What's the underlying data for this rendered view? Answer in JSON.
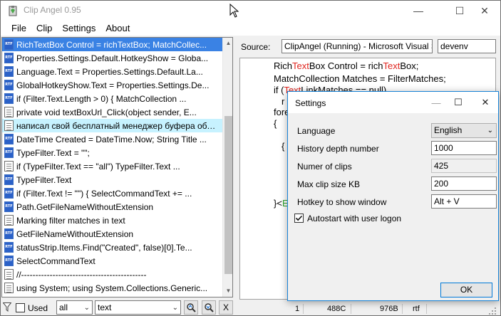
{
  "window": {
    "title": "Clip Angel 0.95",
    "minimize_glyph": "—",
    "maximize_glyph": "☐",
    "close_glyph": "✕"
  },
  "menu": [
    "File",
    "Clip",
    "Settings",
    "About"
  ],
  "clips": [
    {
      "icon": "rtf",
      "text": "RichTextBox Control = richTextBox; MatchCollec...",
      "state": "selected"
    },
    {
      "icon": "rtf",
      "text": "Properties.Settings.Default.HotkeyShow = Globa...",
      "state": ""
    },
    {
      "icon": "rtf",
      "text": "Language.Text = Properties.Settings.Default.La...",
      "state": ""
    },
    {
      "icon": "rtf",
      "text": "GlobalHotkeyShow.Text = Properties.Settings.De...",
      "state": ""
    },
    {
      "icon": "rtf",
      "text": "if (Filter.Text.Length > 0) { MatchCollection ...",
      "state": ""
    },
    {
      "icon": "txt",
      "text": "private void textBoxUrl_Click(object sender, E...",
      "state": ""
    },
    {
      "icon": "txt",
      "text": "написал свой бесплатный менеджер буфера обмена...",
      "state": "highlight"
    },
    {
      "icon": "rtf",
      "text": "DateTime Created = DateTime.Now; String Title ...",
      "state": ""
    },
    {
      "icon": "rtf",
      "text": "TypeFilter.Text = \"\";",
      "state": ""
    },
    {
      "icon": "txt",
      "text": "if (TypeFilter.Text == \"all\") TypeFilter.Text ...",
      "state": ""
    },
    {
      "icon": "rtf",
      "text": "TypeFilter.Text",
      "state": ""
    },
    {
      "icon": "rtf",
      "text": "if (Filter.Text != \"\") { SelectCommandText += ...",
      "state": ""
    },
    {
      "icon": "rtf",
      "text": "Path.GetFileNameWithoutExtension",
      "state": ""
    },
    {
      "icon": "txt",
      "text": "Marking filter matches in text",
      "state": ""
    },
    {
      "icon": "rtf",
      "text": "GetFileNameWithoutExtension",
      "state": ""
    },
    {
      "icon": "rtf",
      "text": "statusStrip.Items.Find(\"Created\", false)[0].Te...",
      "state": ""
    },
    {
      "icon": "rtf",
      "text": "SelectCommandText",
      "state": ""
    },
    {
      "icon": "txt",
      "text": "//--------------------------------------------",
      "state": ""
    },
    {
      "icon": "txt",
      "text": "using System; using System.Collections.Generic...",
      "state": ""
    }
  ],
  "filter": {
    "used_label": "Used",
    "type_value": "all",
    "text_value": "text",
    "clear_glyph": "X"
  },
  "source": {
    "label": "Source:",
    "window_value": "ClipAngel (Running) - Microsoft Visual Studio",
    "process_value": "devenv"
  },
  "code_lines": [
    [
      {
        "t": "Rich"
      },
      {
        "t": "Text",
        "c": "red"
      },
      {
        "t": "Box Control = rich"
      },
      {
        "t": "Text",
        "c": "red"
      },
      {
        "t": "Box;"
      }
    ],
    [
      {
        "t": "MatchCollection Matches = FilterMatches;"
      }
    ],
    [
      {
        "t": "if ("
      },
      {
        "t": "Text",
        "c": "red"
      },
      {
        "t": "LinkMatches == null)"
      }
    ],
    [
      {
        "t": "r"
      }
    ],
    [
      {
        "t": "fore"
      }
    ],
    [
      {
        "t": "{"
      }
    ],
    [
      {
        "t": "i"
      }
    ],
    [
      {
        "t": "{"
      }
    ],
    [
      {
        "t": "}"
      }
    ],
    [
      {
        "t": "}<"
      },
      {
        "t": "E",
        "c": "grn"
      }
    ]
  ],
  "status": {
    "line": "1",
    "chars": "488C",
    "size": "976B",
    "type": "rtf"
  },
  "settings": {
    "title": "Settings",
    "close_glyph": "✕",
    "maximize_glyph": "☐",
    "language_label": "Language",
    "language_value": "English",
    "history_label": "History depth number",
    "history_value": "1000",
    "clips_label": "Numer of clips",
    "clips_value": "425",
    "maxsize_label": "Max clip size KB",
    "maxsize_value": "200",
    "hotkey_label": "Hotkey to show window",
    "hotkey_value": "Alt + V",
    "autostart_label": "Autostart with user logon",
    "autostart_checked": true,
    "ok_label": "OK"
  }
}
